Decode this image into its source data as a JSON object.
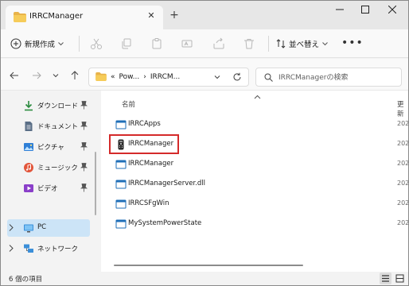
{
  "window": {
    "tab_title": "IRRCManager",
    "add_tab": "+"
  },
  "toolbar": {
    "new_label": "新規作成",
    "sort_label": "並べ替え"
  },
  "address": {
    "overflow": "«",
    "crumbs": [
      "Pow...",
      "IRRCM..."
    ]
  },
  "search": {
    "placeholder": "IRRCManagerの検索"
  },
  "nav": {
    "items": [
      {
        "label": "ダウンロード",
        "icon": "download-icon",
        "pinned": true
      },
      {
        "label": "ドキュメント",
        "icon": "document-icon",
        "pinned": true
      },
      {
        "label": "ピクチャ",
        "icon": "picture-icon",
        "pinned": true
      },
      {
        "label": "ミュージック",
        "icon": "music-icon",
        "pinned": true
      },
      {
        "label": "ビデオ",
        "icon": "video-icon",
        "pinned": true
      },
      {
        "label": "PC",
        "icon": "pc-icon",
        "selected": true
      },
      {
        "label": "ネットワーク",
        "icon": "network-icon"
      }
    ]
  },
  "list": {
    "col_name": "名前",
    "col_date": "更新",
    "files": [
      {
        "name": "IRRCApps",
        "icon": "window-app-icon",
        "date": "202"
      },
      {
        "name": "IRRCManager",
        "icon": "remote-app-icon",
        "date": "202",
        "highlighted": true
      },
      {
        "name": "IRRCManager",
        "icon": "window-app-icon",
        "date": "202"
      },
      {
        "name": "IRRCManagerServer.dll",
        "icon": "window-app-icon",
        "date": "202"
      },
      {
        "name": "IRRCSFgWin",
        "icon": "window-app-icon",
        "date": "202"
      },
      {
        "name": "MySystemPowerState",
        "icon": "window-app-icon",
        "date": "202"
      }
    ]
  },
  "status": {
    "count": "6 個の項目"
  }
}
